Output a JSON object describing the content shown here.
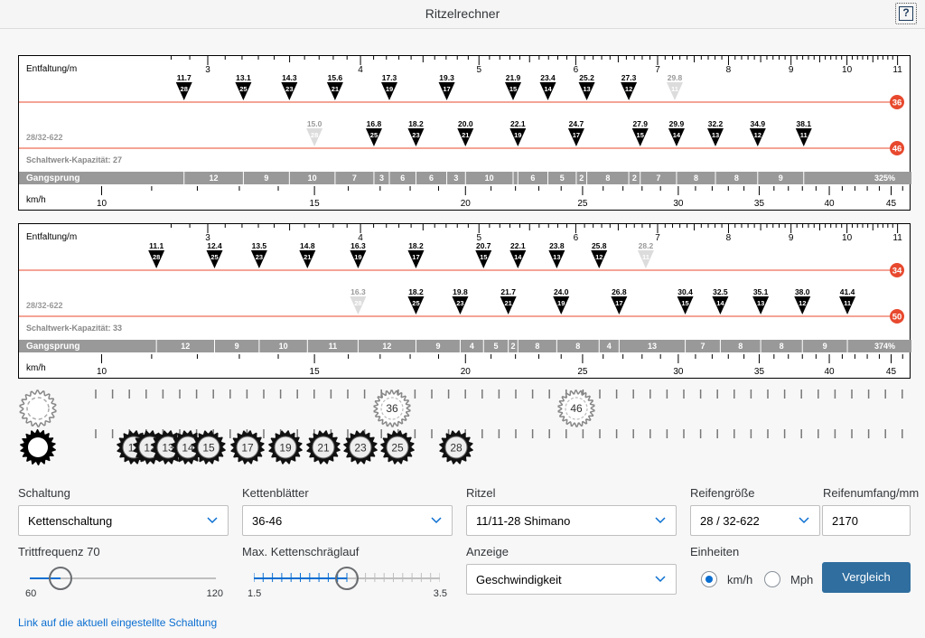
{
  "app": {
    "title": "Ritzelrechner",
    "help_icon": "?"
  },
  "charts": [
    {
      "entfaltung_label": "Entfaltung/m",
      "tire_label": "28/32-622",
      "capacity_label": "Schaltwerk-Kapazität: 27",
      "gangsprung_label": "Gangsprung",
      "gangsprung_total": "325%",
      "speed_label": "km/h",
      "chainrings": [
        {
          "teeth": "36",
          "gears": [
            {
              "v": "11.7",
              "cog": "28",
              "faded": false
            },
            {
              "v": "13.1",
              "cog": "25",
              "faded": false
            },
            {
              "v": "14.3",
              "cog": "23",
              "faded": false
            },
            {
              "v": "15.6",
              "cog": "21",
              "faded": false
            },
            {
              "v": "17.3",
              "cog": "19",
              "faded": false
            },
            {
              "v": "19.3",
              "cog": "17",
              "faded": false
            },
            {
              "v": "21.9",
              "cog": "15",
              "faded": false
            },
            {
              "v": "23.4",
              "cog": "14",
              "faded": false
            },
            {
              "v": "25.2",
              "cog": "13",
              "faded": false
            },
            {
              "v": "27.3",
              "cog": "12",
              "faded": false
            },
            {
              "v": "29.8",
              "cog": "11",
              "faded": true
            }
          ]
        },
        {
          "teeth": "46",
          "gears": [
            {
              "v": "15.0",
              "cog": "28",
              "faded": true
            },
            {
              "v": "16.8",
              "cog": "25",
              "faded": false
            },
            {
              "v": "18.2",
              "cog": "23",
              "faded": false
            },
            {
              "v": "20.0",
              "cog": "21",
              "faded": false
            },
            {
              "v": "22.1",
              "cog": "19",
              "faded": false
            },
            {
              "v": "24.7",
              "cog": "17",
              "faded": false
            },
            {
              "v": "27.9",
              "cog": "15",
              "faded": false
            },
            {
              "v": "29.9",
              "cog": "14",
              "faded": false
            },
            {
              "v": "32.2",
              "cog": "13",
              "faded": false
            },
            {
              "v": "34.9",
              "cog": "12",
              "faded": false
            },
            {
              "v": "38.1",
              "cog": "11",
              "faded": false
            }
          ]
        }
      ],
      "gangsprung_steps": [
        {
          "v": "12",
          "a": 11.7,
          "b": 13.1
        },
        {
          "v": "9",
          "a": 13.1,
          "b": 14.3
        },
        {
          "v": "10",
          "a": 14.3,
          "b": 15.6
        },
        {
          "v": "7",
          "a": 15.6,
          "b": 16.8
        },
        {
          "v": "3",
          "a": 16.8,
          "b": 17.3
        },
        {
          "v": "6",
          "a": 17.3,
          "b": 18.2
        },
        {
          "v": "6",
          "a": 18.2,
          "b": 19.3
        },
        {
          "v": "3",
          "a": 19.3,
          "b": 20.0
        },
        {
          "v": "10",
          "a": 20.0,
          "b": 21.9
        },
        {
          "v": "",
          "a": 21.9,
          "b": 22.1
        },
        {
          "v": "6",
          "a": 22.1,
          "b": 23.4
        },
        {
          "v": "5",
          "a": 23.4,
          "b": 24.7
        },
        {
          "v": "2",
          "a": 24.7,
          "b": 25.2
        },
        {
          "v": "8",
          "a": 25.2,
          "b": 27.3
        },
        {
          "v": "2",
          "a": 27.3,
          "b": 27.9
        },
        {
          "v": "7",
          "a": 27.9,
          "b": 29.9
        },
        {
          "v": "8",
          "a": 29.9,
          "b": 32.2
        },
        {
          "v": "8",
          "a": 32.2,
          "b": 34.9
        },
        {
          "v": "9",
          "a": 34.9,
          "b": 38.1
        }
      ]
    },
    {
      "entfaltung_label": "Entfaltung/m",
      "tire_label": "28/32-622",
      "capacity_label": "Schaltwerk-Kapazität: 33",
      "gangsprung_label": "Gangsprung",
      "gangsprung_total": "374%",
      "speed_label": "km/h",
      "chainrings": [
        {
          "teeth": "34",
          "gears": [
            {
              "v": "11.1",
              "cog": "28",
              "faded": false
            },
            {
              "v": "12.4",
              "cog": "25",
              "faded": false
            },
            {
              "v": "13.5",
              "cog": "23",
              "faded": false
            },
            {
              "v": "14.8",
              "cog": "21",
              "faded": false
            },
            {
              "v": "16.3",
              "cog": "19",
              "faded": false
            },
            {
              "v": "18.2",
              "cog": "17",
              "faded": false
            },
            {
              "v": "20.7",
              "cog": "15",
              "faded": false
            },
            {
              "v": "22.1",
              "cog": "14",
              "faded": false
            },
            {
              "v": "23.8",
              "cog": "13",
              "faded": false
            },
            {
              "v": "25.8",
              "cog": "12",
              "faded": false
            },
            {
              "v": "28.2",
              "cog": "11",
              "faded": true
            }
          ]
        },
        {
          "teeth": "50",
          "gears": [
            {
              "v": "16.3",
              "cog": "28",
              "faded": true
            },
            {
              "v": "18.2",
              "cog": "25",
              "faded": false
            },
            {
              "v": "19.8",
              "cog": "23",
              "faded": false
            },
            {
              "v": "21.7",
              "cog": "21",
              "faded": false
            },
            {
              "v": "24.0",
              "cog": "19",
              "faded": false
            },
            {
              "v": "26.8",
              "cog": "17",
              "faded": false
            },
            {
              "v": "30.4",
              "cog": "15",
              "faded": false
            },
            {
              "v": "32.5",
              "cog": "14",
              "faded": false
            },
            {
              "v": "35.1",
              "cog": "13",
              "faded": false
            },
            {
              "v": "38.0",
              "cog": "12",
              "faded": false
            },
            {
              "v": "41.4",
              "cog": "11",
              "faded": false
            }
          ]
        }
      ],
      "gangsprung_steps": [
        {
          "v": "12",
          "a": 11.1,
          "b": 12.4
        },
        {
          "v": "9",
          "a": 12.4,
          "b": 13.5
        },
        {
          "v": "10",
          "a": 13.5,
          "b": 14.8
        },
        {
          "v": "11",
          "a": 14.8,
          "b": 16.3
        },
        {
          "v": "12",
          "a": 16.3,
          "b": 18.2
        },
        {
          "v": "9",
          "a": 18.2,
          "b": 19.8
        },
        {
          "v": "4",
          "a": 19.8,
          "b": 20.7
        },
        {
          "v": "5",
          "a": 20.7,
          "b": 21.7
        },
        {
          "v": "2",
          "a": 21.7,
          "b": 22.1
        },
        {
          "v": "8",
          "a": 22.1,
          "b": 23.8
        },
        {
          "v": "8",
          "a": 23.8,
          "b": 25.8
        },
        {
          "v": "4",
          "a": 25.8,
          "b": 26.8
        },
        {
          "v": "13",
          "a": 26.8,
          "b": 30.4
        },
        {
          "v": "7",
          "a": 30.4,
          "b": 32.5
        },
        {
          "v": "8",
          "a": 32.5,
          "b": 35.1
        },
        {
          "v": "8",
          "a": 35.1,
          "b": 38.0
        },
        {
          "v": "9",
          "a": 38.0,
          "b": 41.4
        }
      ]
    }
  ],
  "axes": {
    "entfaltung_ticks": [
      "3",
      "4",
      "5",
      "6",
      "7",
      "8",
      "9",
      "10",
      "11"
    ],
    "speed_ticks": [
      "10",
      "15",
      "20",
      "25",
      "30",
      "35",
      "40",
      "45"
    ]
  },
  "drivetrain": {
    "chainrings": [
      "36",
      "46"
    ],
    "cogs": [
      "11",
      "12",
      "13",
      "14",
      "15",
      "17",
      "19",
      "21",
      "23",
      "25",
      "28"
    ],
    "icons": [
      "gear-outline-icon",
      "gear-filled-icon"
    ]
  },
  "form": {
    "schaltung": {
      "label": "Schaltung",
      "value": "Kettenschaltung"
    },
    "kettenblaetter": {
      "label": "Kettenblätter",
      "value": "36-46"
    },
    "ritzel": {
      "label": "Ritzel",
      "value": "11/11-28 Shimano"
    },
    "reifengroesse": {
      "label": "Reifengröße",
      "value": "28 / 32-622"
    },
    "reifenumfang": {
      "label": "Reifenumfang/mm",
      "value": "2170"
    },
    "trittfrequenz": {
      "label": "Trittfrequenz 70",
      "min": "60",
      "max": "120",
      "value": 70
    },
    "kettenschraeglauf": {
      "label": "Max. Kettenschräglauf",
      "min": "1.5",
      "max": "3.5",
      "value": 2.5
    },
    "anzeige": {
      "label": "Anzeige",
      "value": "Geschwindigkeit"
    },
    "einheiten": {
      "label": "Einheiten",
      "option_kmh": "km/h",
      "option_mph": "Mph",
      "selected": "km/h"
    },
    "compare_button": "Vergleich",
    "link": "Link auf die aktuell eingestellte Schaltung"
  },
  "colors": {
    "accent": "#0a6ed1",
    "chainring_line": "#e8492e",
    "chainring_badge": "#e8492e",
    "button": "#2f6e9f"
  }
}
